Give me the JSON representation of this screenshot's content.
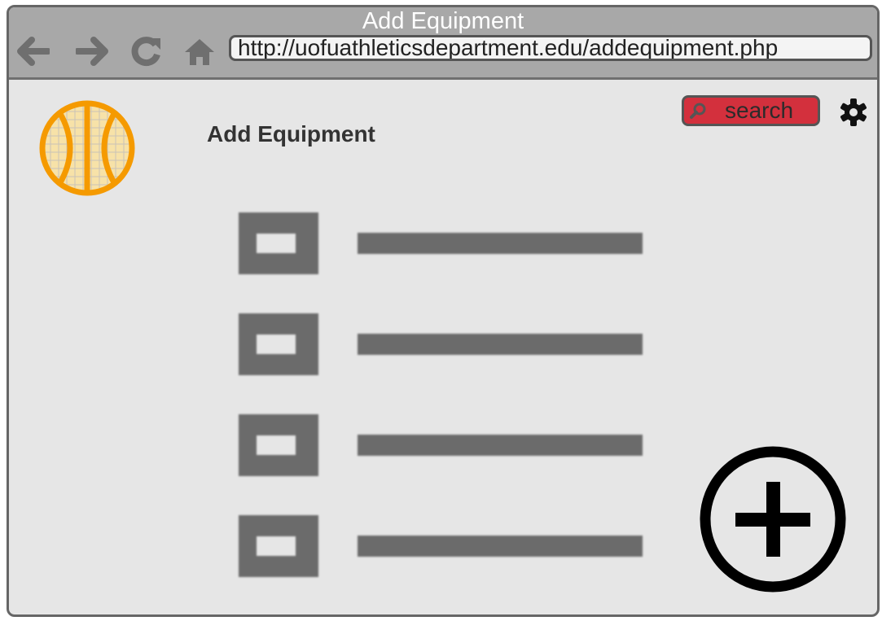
{
  "window": {
    "title": "Add Equipment",
    "url": "http://uofuathleticsdepartment.edu/addequipment.php"
  },
  "nav": {
    "back_icon": "arrow-left-icon",
    "forward_icon": "arrow-right-icon",
    "reload_icon": "reload-icon",
    "home_icon": "home-icon"
  },
  "header": {
    "logo_icon": "basketball-icon",
    "page_title": "Add Equipment",
    "search_placeholder": "search",
    "settings_icon": "gear-icon"
  },
  "equipment_list": {
    "item_count_visible": 4,
    "placeholder_image_icon": "image-placeholder-icon"
  },
  "add_button": {
    "icon": "plus-circle-icon"
  },
  "colors": {
    "titlebar": "#a8a8a8",
    "page_background": "#e6e6e6",
    "search_background": "#d3303d",
    "logo_orange": "#f59a00",
    "placeholder_gray": "#6b6b6b"
  }
}
